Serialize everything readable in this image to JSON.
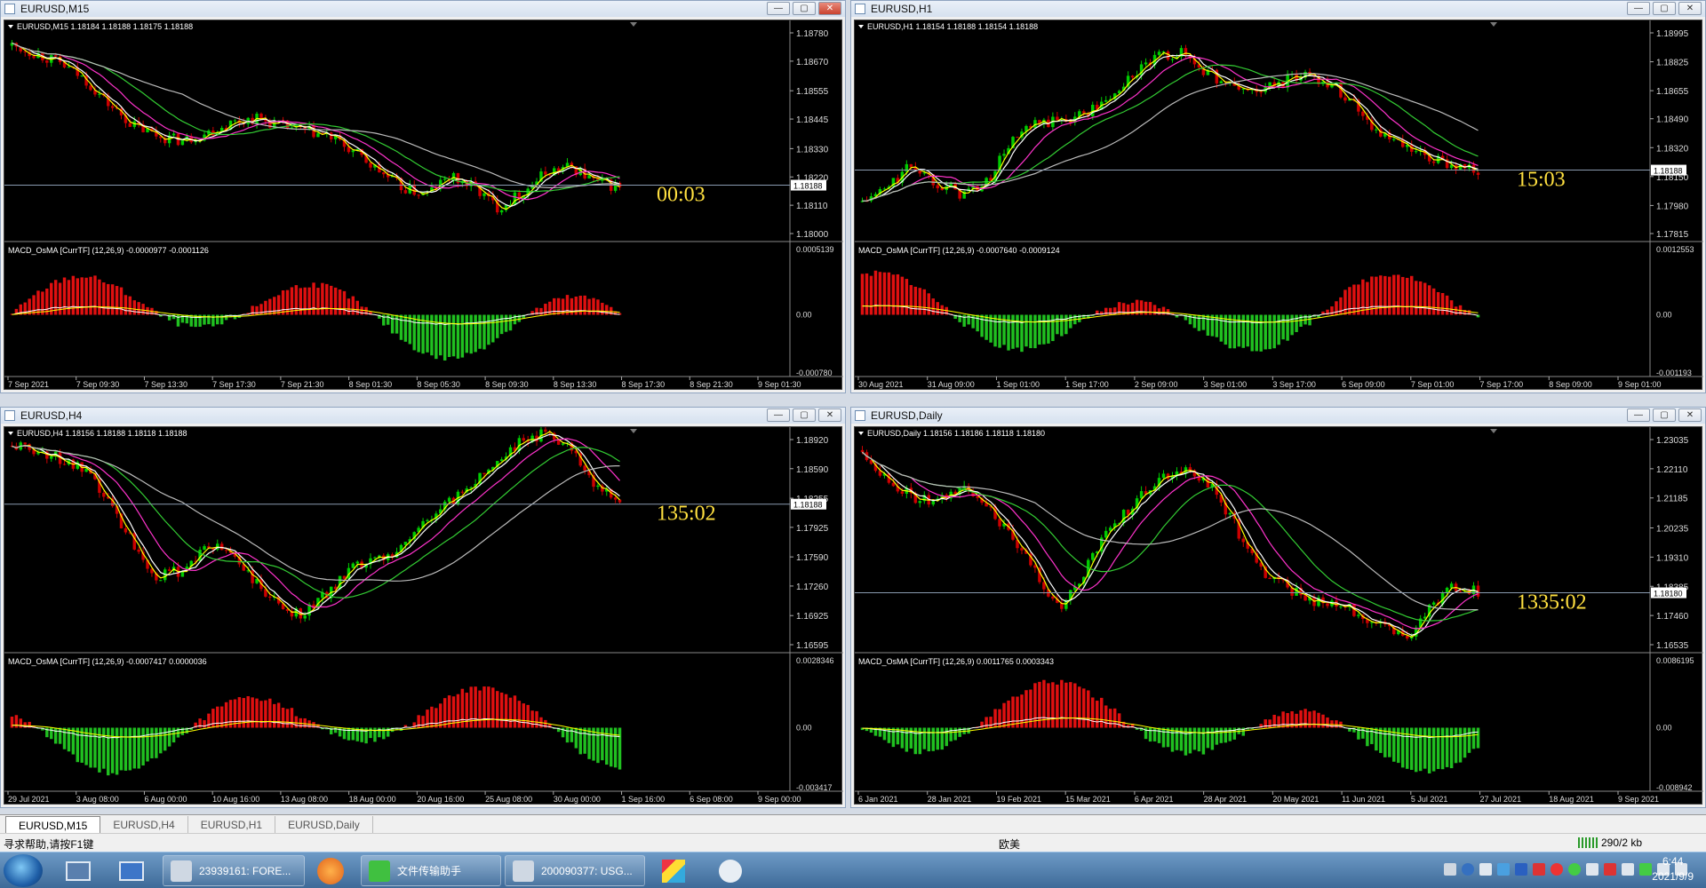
{
  "charts": [
    {
      "title": "EURUSD,M15",
      "info": "EURUSD,M15  1.18184 1.18188 1.18175 1.18188",
      "price_labels": [
        "1.18780",
        "1.18670",
        "1.18555",
        "1.18445",
        "1.18330",
        "1.18220",
        "1.18110",
        "1.18000"
      ],
      "price_min": 1.18,
      "price_max": 1.1878,
      "current_price": "1.18188",
      "timer": "00:03",
      "macd_info": "MACD_OsMA [CurrTF] (12,26,9) -0.0000977 -0.0001126",
      "macd_labels": [
        "0.0005139",
        "0.00",
        "-0.000780"
      ],
      "time_labels": [
        "7 Sep 2021",
        "7 Sep 09:30",
        "7 Sep 13:30",
        "7 Sep 17:30",
        "7 Sep 21:30",
        "8 Sep 01:30",
        "8 Sep 05:30",
        "8 Sep 09:30",
        "8 Sep 13:30",
        "8 Sep 17:30",
        "8 Sep 21:30",
        "9 Sep 01:30"
      ],
      "series": [
        1.1873,
        1.187,
        1.1866,
        1.186,
        1.185,
        1.1842,
        1.1838,
        1.1836,
        1.1839,
        1.1843,
        1.1845,
        1.1842,
        1.184,
        1.1838,
        1.1832,
        1.1825,
        1.1818,
        1.1815,
        1.1822,
        1.1818,
        1.181,
        1.1816,
        1.1824,
        1.1826,
        1.182,
        1.1818
      ]
    },
    {
      "title": "EURUSD,H1",
      "info": "EURUSD,H1  1.18154 1.18188 1.18154 1.18188",
      "price_labels": [
        "1.18995",
        "1.18825",
        "1.18655",
        "1.18490",
        "1.18320",
        "1.18150",
        "1.17980",
        "1.17815"
      ],
      "price_min": 1.17815,
      "price_max": 1.18995,
      "current_price": "1.18188",
      "timer": "15:03",
      "macd_info": "MACD_OsMA [CurrTF] (12,26,9) -0.0007640 -0.0009124",
      "macd_labels": [
        "0.0012553",
        "0.00",
        "-0.001193"
      ],
      "time_labels": [
        "30 Aug 2021",
        "31 Aug 09:00",
        "1 Sep 01:00",
        "1 Sep 17:00",
        "2 Sep 09:00",
        "3 Sep 01:00",
        "3 Sep 17:00",
        "6 Sep 09:00",
        "7 Sep 01:00",
        "7 Sep 17:00",
        "8 Sep 09:00",
        "9 Sep 01:00"
      ],
      "series": [
        1.18,
        1.1808,
        1.1822,
        1.1812,
        1.1805,
        1.181,
        1.1835,
        1.1845,
        1.1848,
        1.1852,
        1.186,
        1.1875,
        1.1885,
        1.1888,
        1.1876,
        1.1868,
        1.1865,
        1.187,
        1.1876,
        1.187,
        1.1858,
        1.184,
        1.1832,
        1.1825,
        1.1822,
        1.1819
      ]
    },
    {
      "title": "EURUSD,H4",
      "info": "EURUSD,H4  1.18156 1.18188 1.18118 1.18188",
      "price_labels": [
        "1.18920",
        "1.18590",
        "1.18255",
        "1.17925",
        "1.17590",
        "1.17260",
        "1.16925",
        "1.16595"
      ],
      "price_min": 1.16595,
      "price_max": 1.1892,
      "current_price": "1.18188",
      "timer": "135:02",
      "macd_info": "MACD_OsMA [CurrTF] (12,26,9) -0.0007417 0.0000036",
      "macd_labels": [
        "0.0028346",
        "0.00",
        "-0.003417"
      ],
      "time_labels": [
        "29 Jul 2021",
        "3 Aug 08:00",
        "6 Aug 00:00",
        "10 Aug 16:00",
        "13 Aug 08:00",
        "18 Aug 00:00",
        "20 Aug 16:00",
        "25 Aug 08:00",
        "30 Aug 00:00",
        "1 Sep 16:00",
        "6 Sep 08:00",
        "9 Sep 00:00"
      ],
      "series": [
        1.1885,
        1.188,
        1.187,
        1.1855,
        1.182,
        1.1775,
        1.1735,
        1.1745,
        1.177,
        1.1765,
        1.173,
        1.1702,
        1.1695,
        1.172,
        1.1745,
        1.1755,
        1.177,
        1.18,
        1.182,
        1.1845,
        1.187,
        1.189,
        1.19,
        1.1885,
        1.184,
        1.1819
      ]
    },
    {
      "title": "EURUSD,Daily",
      "info": "EURUSD,Daily  1.18156 1.18186 1.18118 1.18180",
      "price_labels": [
        "1.23035",
        "1.22110",
        "1.21185",
        "1.20235",
        "1.19310",
        "1.18385",
        "1.17460",
        "1.16535"
      ],
      "price_min": 1.16535,
      "price_max": 1.23035,
      "current_price": "1.18180",
      "timer": "1335:02",
      "macd_info": "MACD_OsMA [CurrTF] (12,26,9) 0.0011765 0.0003343",
      "macd_labels": [
        "0.0086195",
        "0.00",
        "-0.008942"
      ],
      "time_labels": [
        "6 Jan 2021",
        "28 Jan 2021",
        "19 Feb 2021",
        "15 Mar 2021",
        "6 Apr 2021",
        "28 Apr 2021",
        "20 May 2021",
        "11 Jun 2021",
        "5 Jul 2021",
        "27 Jul 2021",
        "18 Aug 2021",
        "9 Sep 2021"
      ],
      "series": [
        1.227,
        1.218,
        1.212,
        1.21,
        1.215,
        1.211,
        1.199,
        1.189,
        1.176,
        1.188,
        1.202,
        1.21,
        1.218,
        1.221,
        1.217,
        1.205,
        1.19,
        1.185,
        1.18,
        1.178,
        1.176,
        1.172,
        1.167,
        1.176,
        1.184,
        1.1818
      ]
    }
  ],
  "tabs": [
    "EURUSD,M15",
    "EURUSD,H4",
    "EURUSD,H1",
    "EURUSD,Daily"
  ],
  "active_tab": 0,
  "status": {
    "help": "寻求帮助,请按F1键",
    "profile": "欧美",
    "traffic": "290/2 kb"
  },
  "taskbar": {
    "items": [
      "23939161: FORE...",
      "文件传输助手",
      "200090377: USG..."
    ],
    "time": "6:44",
    "date": "2021/9/9"
  },
  "colors": {
    "bull": "#00cc00",
    "bear": "#cc0000",
    "ma_fast": "#ffff00",
    "ma_white": "#ffffff",
    "ma_magenta": "#ff33cc",
    "ma_green": "#33cc33",
    "ma_gray": "#bbbbbb",
    "timer": "#ffe040"
  }
}
